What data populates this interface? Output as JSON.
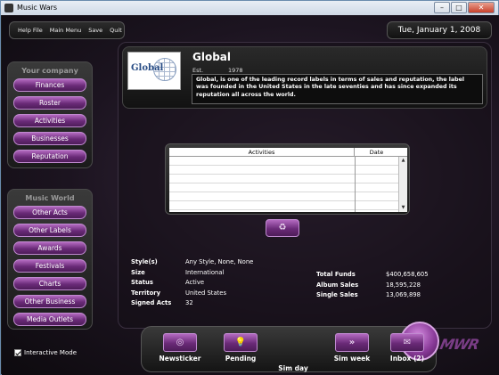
{
  "window": {
    "title": "Music Wars",
    "controls": {
      "minimize": "–",
      "maximize": "□",
      "close": "✕"
    }
  },
  "menu": {
    "items": [
      "Help File",
      "Main Menu",
      "Save",
      "Quit"
    ]
  },
  "date": "Tue, January 1, 2008",
  "sidebar": {
    "your_company": {
      "header": "Your company",
      "items": [
        "Finances",
        "Roster",
        "Activities",
        "Businesses",
        "Reputation"
      ]
    },
    "music_world": {
      "header": "Music World",
      "items": [
        "Other Acts",
        "Other Labels",
        "Awards",
        "Festivals",
        "Charts",
        "Other Business",
        "Media Outlets"
      ]
    },
    "interactive_mode": {
      "label": "Interactive Mode",
      "checked": true
    }
  },
  "company": {
    "logo_text": "Global",
    "name": "Global",
    "est_label": "Est.",
    "est_year": "1978",
    "description": "Global, is one of the leading record labels in terms of sales and reputation, the label was founded in the United States in the late seventies and has since expanded its reputation all across the world."
  },
  "activities_table": {
    "columns": [
      "Activities",
      "Date"
    ],
    "rows": []
  },
  "stats_left": [
    {
      "label": "Style(s)",
      "value": "Any Style, None, None"
    },
    {
      "label": "Size",
      "value": "International"
    },
    {
      "label": "Status",
      "value": "Active"
    },
    {
      "label": "Territory",
      "value": "United States"
    },
    {
      "label": "Signed Acts",
      "value": "32"
    }
  ],
  "stats_right": [
    {
      "label": "Total Funds",
      "value": "$400,658,605"
    },
    {
      "label": "Album Sales",
      "value": "18,595,228"
    },
    {
      "label": "Single Sales",
      "value": "13,069,898"
    }
  ],
  "bottom_bar": {
    "newsticker": "Newsticker",
    "pending": "Pending",
    "sim_day": "Sim day",
    "sim_week": "Sim week",
    "inbox": "Inbox (2)"
  },
  "brand_logo": "MWR",
  "colors": {
    "accent": "#8a3b99",
    "button_border": "#c08ad0",
    "background": "#1c1420"
  }
}
